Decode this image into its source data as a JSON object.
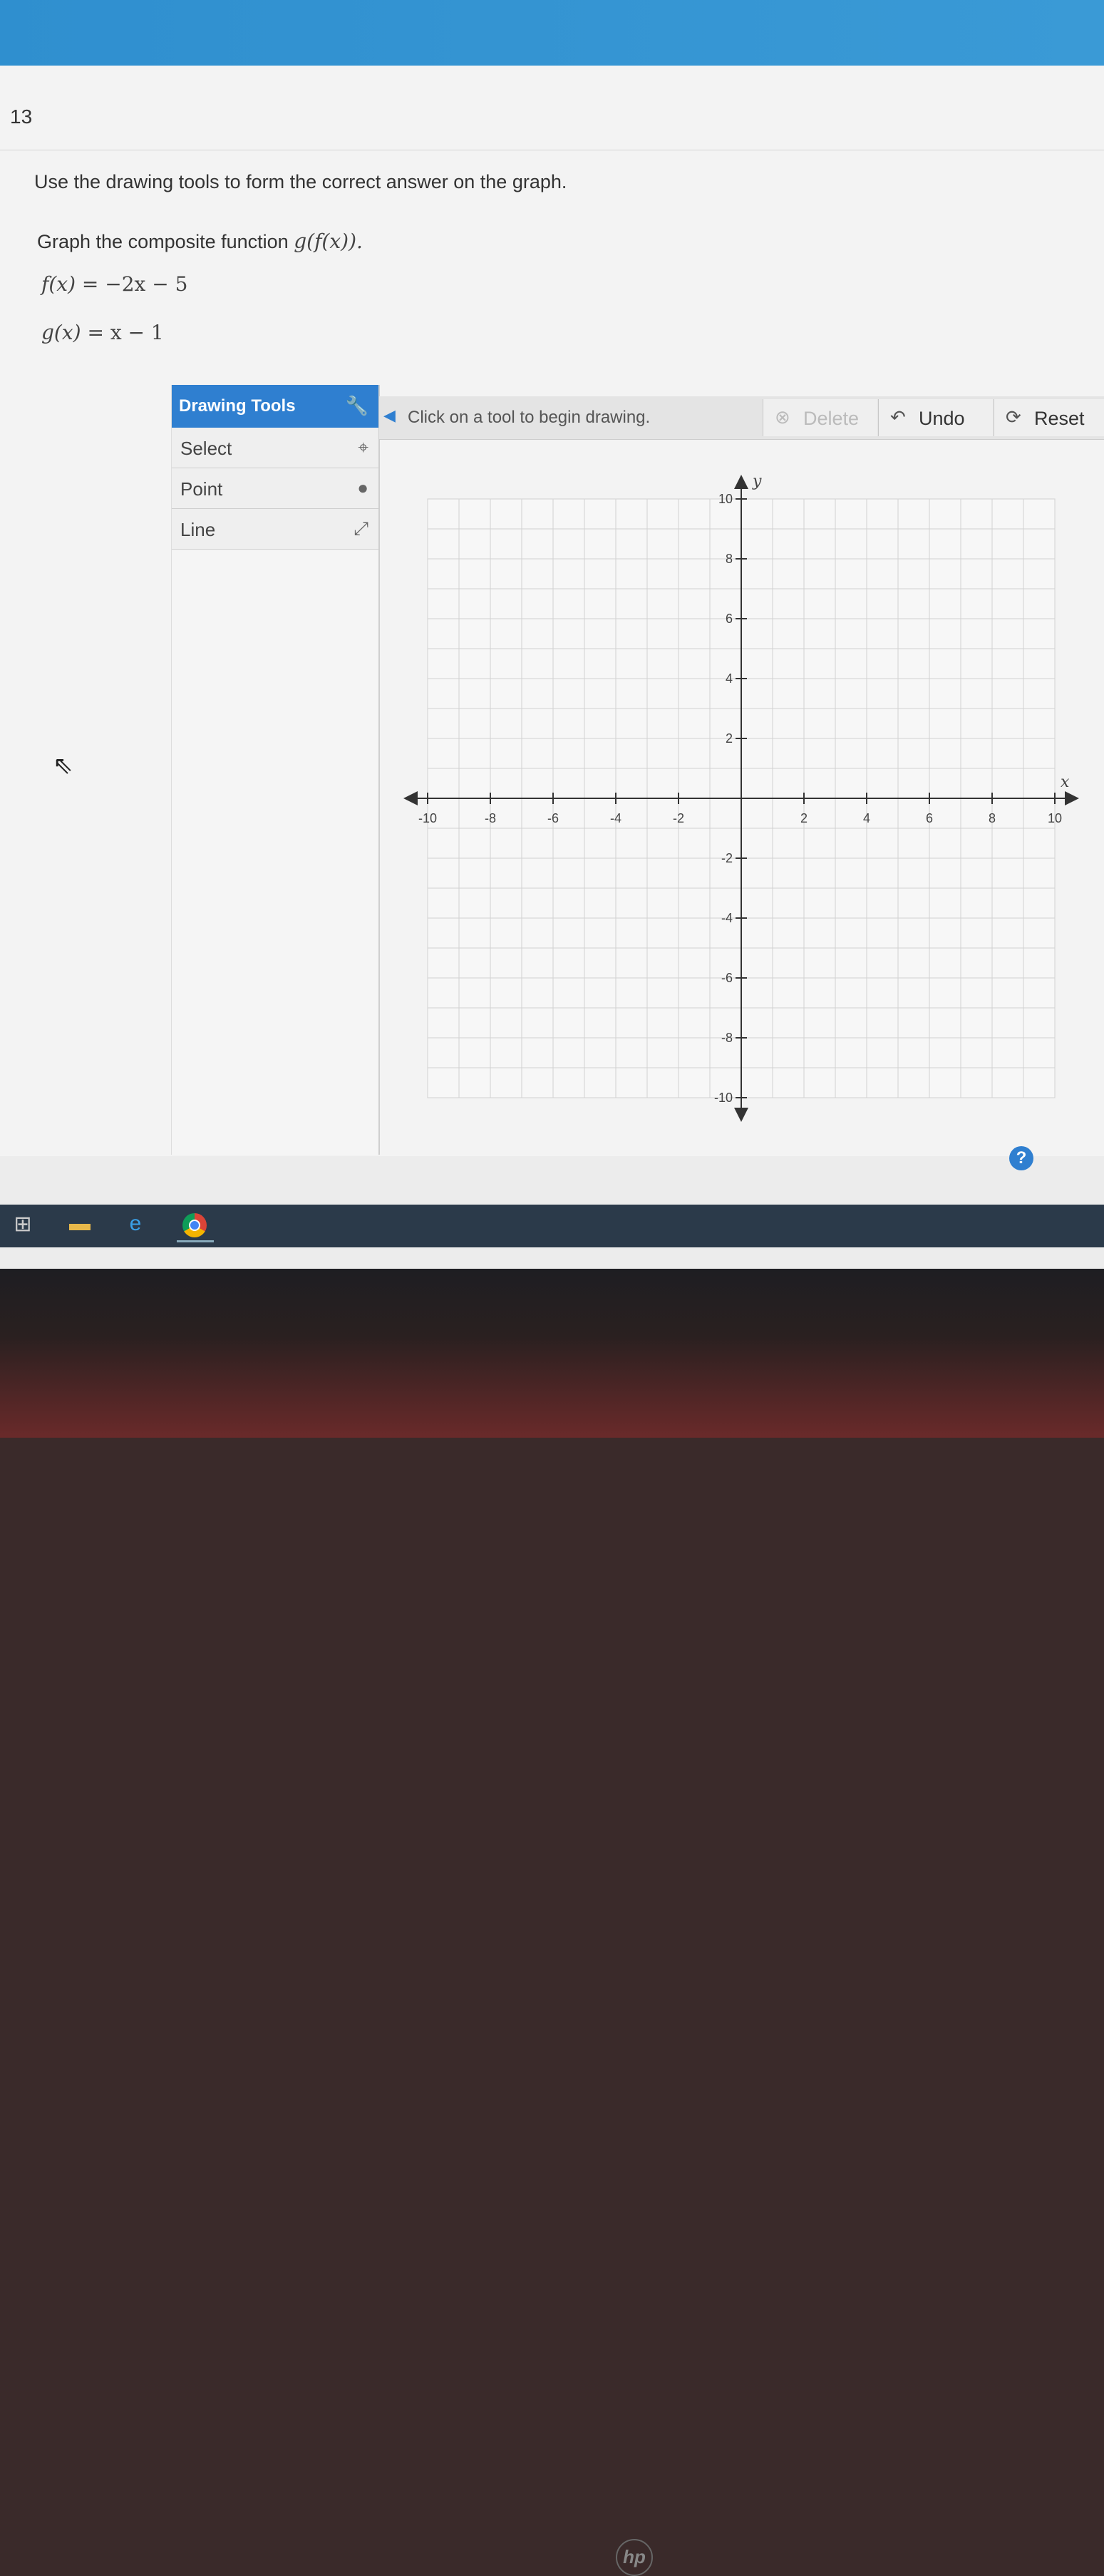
{
  "question": {
    "number": "13",
    "instruction": "Use the drawing tools to form the correct answer on the graph.",
    "prompt": "Graph the composite function",
    "composite": "g(f(x)).",
    "f_label": "f(x)",
    "f_expr": "= −2x − 5",
    "g_label": "g(x)",
    "g_expr": "= x − 1"
  },
  "tools": {
    "header": "Drawing Tools",
    "items": [
      {
        "label": "Select",
        "icon": "select-pointer-icon"
      },
      {
        "label": "Point",
        "icon": "point-dot-icon"
      },
      {
        "label": "Line",
        "icon": "line-arrows-icon"
      }
    ]
  },
  "toolbar": {
    "hint": "Click on a tool to begin drawing.",
    "delete_label": "Delete",
    "undo_label": "Undo",
    "reset_label": "Reset"
  },
  "graph": {
    "x_axis_label": "x",
    "y_axis_label": "y",
    "x_range": [
      -10,
      10
    ],
    "y_range": [
      -10,
      10
    ],
    "x_ticks": [
      -10,
      -8,
      -6,
      -4,
      -2,
      2,
      4,
      6,
      8,
      10
    ],
    "y_ticks": [
      -10,
      -8,
      -6,
      -4,
      -2,
      2,
      4,
      6,
      8,
      10
    ],
    "grid": true
  },
  "help_label": "?",
  "colors": {
    "accent": "#2f7fd0",
    "header_bar": "#3a9ad6"
  }
}
